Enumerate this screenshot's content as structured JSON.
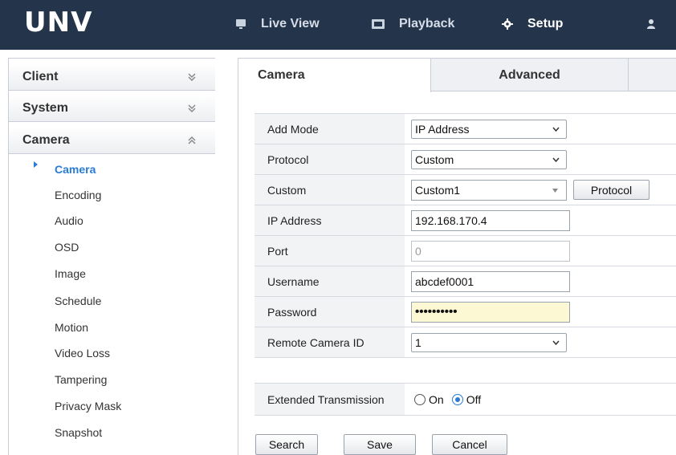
{
  "app": {
    "logo": "UNV",
    "colors": {
      "topbar": "#24354b",
      "accent": "#2a7bd6",
      "password_bg": "#fdf8d4"
    }
  },
  "nav": {
    "items": [
      {
        "label": "Live View",
        "icon": "monitor-icon"
      },
      {
        "label": "Playback",
        "icon": "film-icon"
      },
      {
        "label": "Setup",
        "icon": "gear-icon",
        "active": true
      },
      {
        "label": "",
        "icon": "user-icon"
      }
    ]
  },
  "sidebar": {
    "sections": [
      {
        "label": "Client",
        "expanded": false
      },
      {
        "label": "System",
        "expanded": false
      },
      {
        "label": "Camera",
        "expanded": true
      }
    ],
    "camera_items": [
      {
        "label": "Camera",
        "active": true
      },
      {
        "label": "Encoding"
      },
      {
        "label": "Audio"
      },
      {
        "label": "OSD"
      },
      {
        "label": "Image"
      },
      {
        "label": "Schedule"
      },
      {
        "label": "Motion"
      },
      {
        "label": "Video Loss"
      },
      {
        "label": "Tampering"
      },
      {
        "label": "Privacy Mask"
      },
      {
        "label": "Snapshot"
      }
    ]
  },
  "tabs": [
    {
      "label": "Camera",
      "active": true
    },
    {
      "label": "Advanced"
    }
  ],
  "form": {
    "add_mode": {
      "label": "Add Mode",
      "value": "IP Address"
    },
    "protocol": {
      "label": "Protocol",
      "value": "Custom"
    },
    "custom": {
      "label": "Custom",
      "value": "Custom1",
      "button": "Protocol"
    },
    "ip_address": {
      "label": "IP Address",
      "value": "192.168.170.4"
    },
    "port": {
      "label": "Port",
      "value": "0"
    },
    "username": {
      "label": "Username",
      "value": "abcdef0001"
    },
    "password": {
      "label": "Password",
      "value": "••••••••••"
    },
    "remote_camera_id": {
      "label": "Remote Camera ID",
      "value": "1"
    },
    "extended_transmission": {
      "label": "Extended Transmission",
      "on": "On",
      "off": "Off",
      "selected": "Off"
    }
  },
  "buttons": {
    "search": "Search",
    "save": "Save",
    "cancel": "Cancel"
  }
}
